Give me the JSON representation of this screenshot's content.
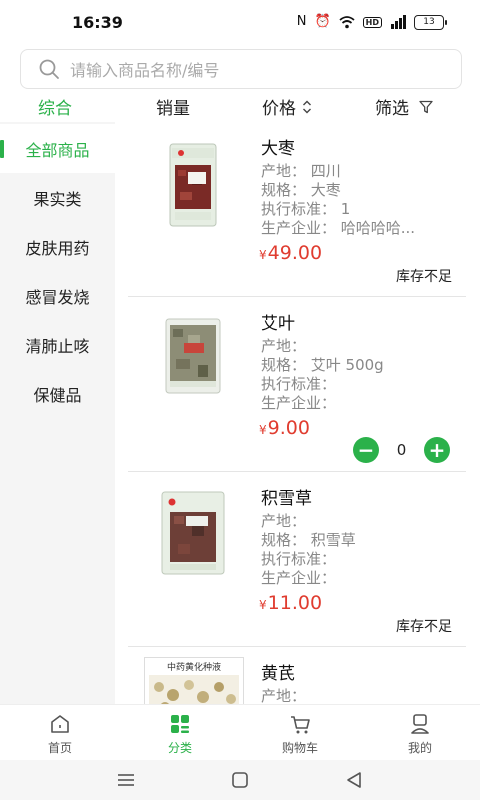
{
  "status_bar": {
    "time": "16:39",
    "battery": "13"
  },
  "search": {
    "placeholder": "请输入商品名称/编号"
  },
  "filters": {
    "comprehensive": "综合",
    "sales": "销量",
    "price": "价格",
    "filter": "筛选"
  },
  "colors": {
    "accent": "#2bb14a",
    "price": "#e03c2f"
  },
  "sidebar": {
    "items": [
      {
        "label": "全部商品",
        "active": true
      },
      {
        "label": "果实类"
      },
      {
        "label": "皮肤用药"
      },
      {
        "label": "感冒发烧"
      },
      {
        "label": "清肺止咳"
      },
      {
        "label": "保健品"
      }
    ]
  },
  "products": [
    {
      "name": "大枣",
      "origin": "产地：  四川",
      "spec": "规格：  大枣",
      "standard": "执行标准：  1",
      "maker": "生产企业：  哈哈哈哈...",
      "currency": "¥",
      "price": "49.00",
      "stock_note": "库存不足"
    },
    {
      "name": "艾叶",
      "origin": "产地：",
      "spec": "规格：  艾叶 500g",
      "standard": "执行标准：",
      "maker": "生产企业：",
      "currency": "¥",
      "price": "9.00",
      "quantity": "0"
    },
    {
      "name": "积雪草",
      "origin": "产地：",
      "spec": "规格：  积雪草",
      "standard": "执行标准：",
      "maker": "生产企业：",
      "currency": "¥",
      "price": "11.00",
      "stock_note": "库存不足"
    },
    {
      "name": "黄芪",
      "origin": "产地：",
      "image_label": "中药黄化种液"
    }
  ],
  "tabs": [
    {
      "label": "首页",
      "icon": "home-icon"
    },
    {
      "label": "分类",
      "icon": "category-icon",
      "active": true
    },
    {
      "label": "购物车",
      "icon": "cart-icon"
    },
    {
      "label": "我的",
      "icon": "profile-icon"
    }
  ]
}
